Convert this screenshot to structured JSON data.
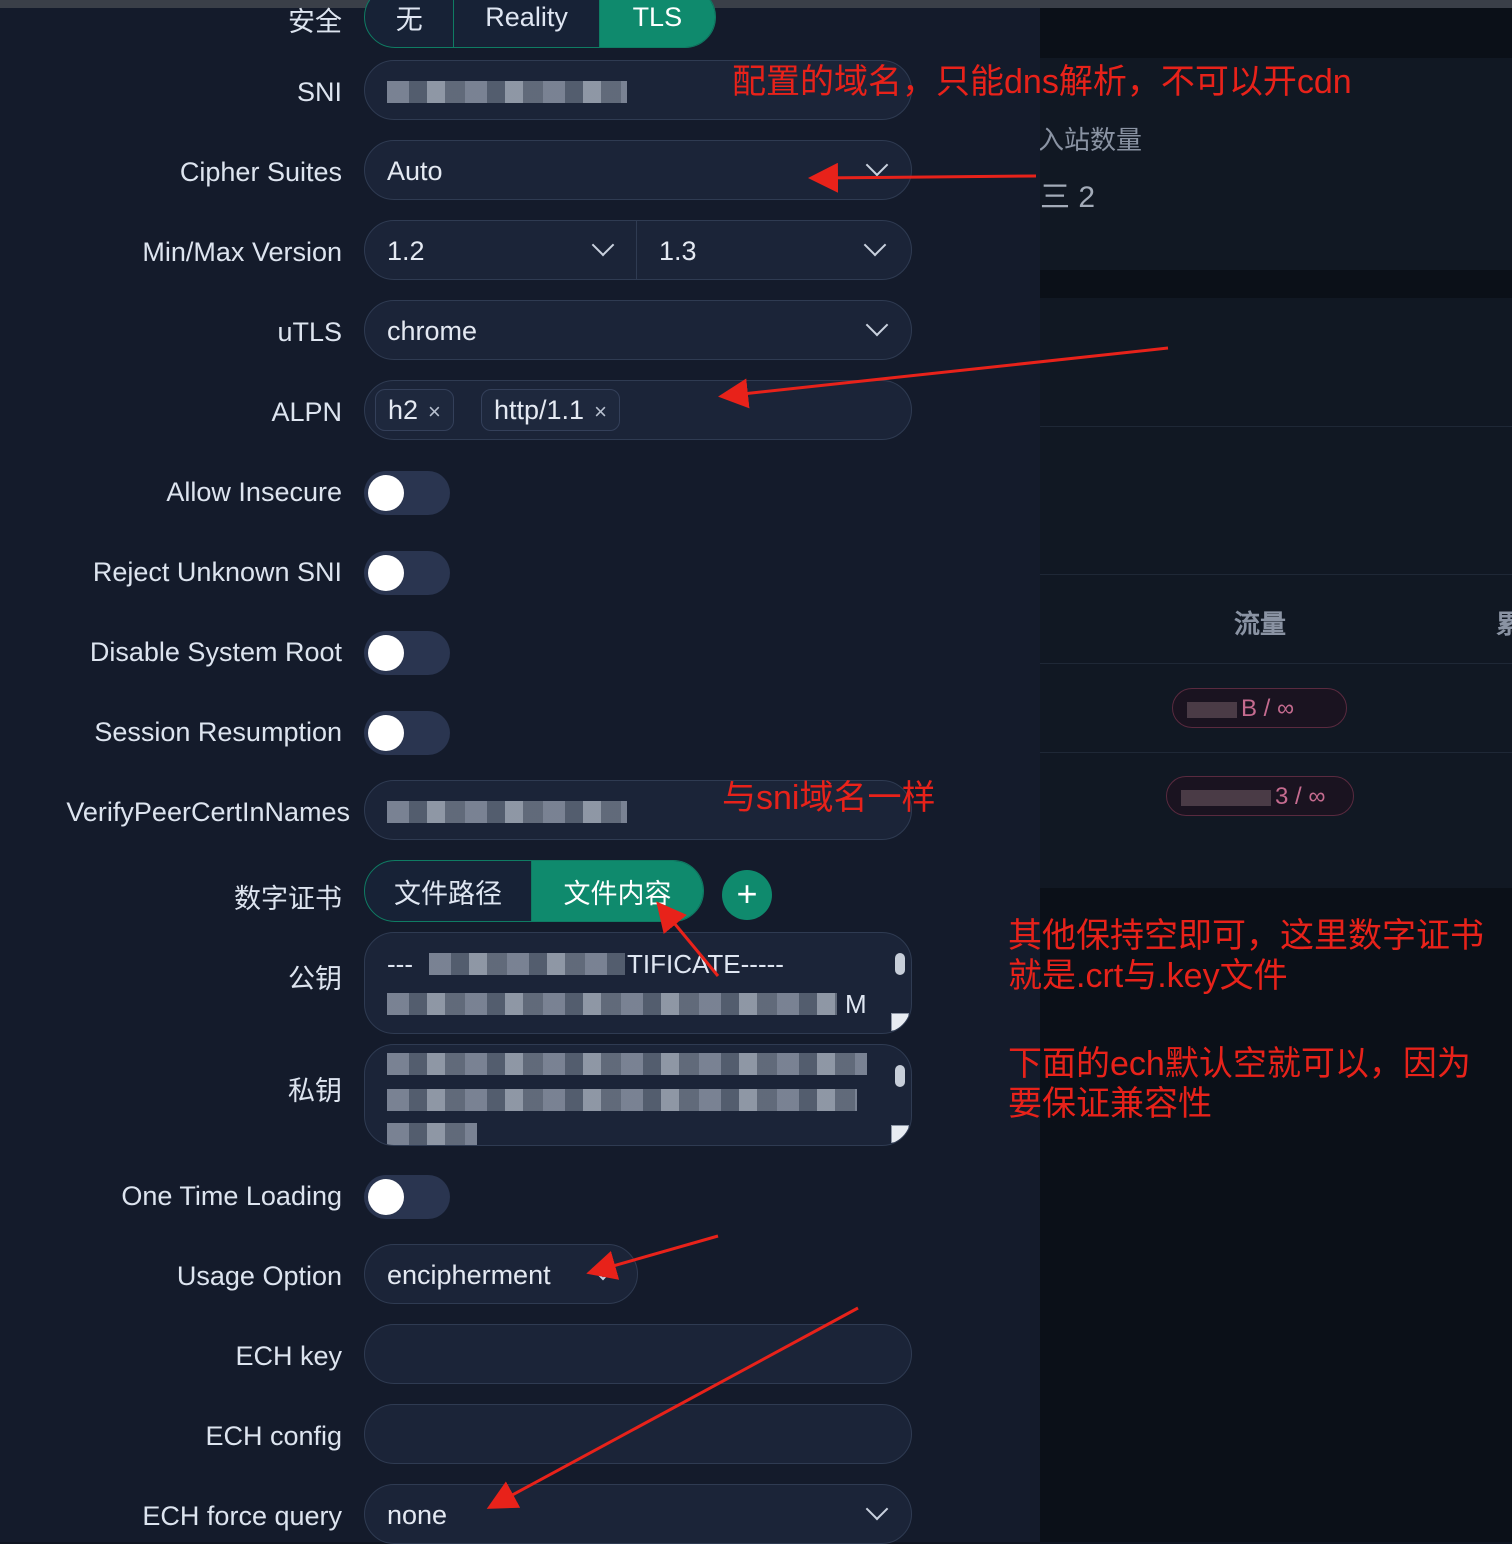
{
  "background_page": {
    "inbound_count_label": "入站数量",
    "inbound_count_value": "三 2",
    "traffic_header": "流量",
    "edge_header_glyph": "累",
    "rows": [
      {
        "traffic": "B / ∞"
      },
      {
        "traffic": "3 / ∞"
      }
    ]
  },
  "security": {
    "label": "安全",
    "options": [
      "无",
      "Reality",
      "TLS"
    ],
    "selected": "TLS"
  },
  "fields": {
    "sni": {
      "label": "SNI",
      "value": ""
    },
    "cipher_suites": {
      "label": "Cipher Suites",
      "value": "Auto"
    },
    "min_max_version": {
      "label": "Min/Max Version",
      "min": "1.2",
      "max": "1.3"
    },
    "utls": {
      "label": "uTLS",
      "value": "chrome"
    },
    "alpn": {
      "label": "ALPN",
      "tags": [
        "h2",
        "http/1.1"
      ],
      "remove_glyph": "×"
    },
    "allow_insecure": {
      "label": "Allow Insecure"
    },
    "reject_unknown_sni": {
      "label": "Reject Unknown SNI"
    },
    "disable_system_root": {
      "label": "Disable System Root"
    },
    "session_resumption": {
      "label": "Session Resumption"
    },
    "verify_peer_cert_in_names": {
      "label": "VerifyPeerCertInNames"
    },
    "certificate": {
      "label": "数字证书",
      "options": [
        "文件路径",
        "文件内容"
      ],
      "selected": "文件内容",
      "add_glyph": "+"
    },
    "public_key": {
      "label": "公钥",
      "visible_start": "---",
      "visible_mid": "TIFICATE-----",
      "visible_end": "M"
    },
    "private_key": {
      "label": "私钥"
    },
    "one_time_loading": {
      "label": "One Time Loading"
    },
    "usage_option": {
      "label": "Usage Option",
      "value": "encipherment"
    },
    "ech_key": {
      "label": "ECH key",
      "value": ""
    },
    "ech_config": {
      "label": "ECH config",
      "value": ""
    },
    "ech_force_query": {
      "label": "ECH force query",
      "value": "none"
    }
  },
  "annotations": {
    "sni_note": "配置的域名，只能dns解析，不可以开cdn",
    "verify_note": "与sni域名一样",
    "cert_note_line1": "其他保持空即可，这里数字证书",
    "cert_note_line2": "就是.crt与.key文件",
    "ech_note_line1": "下面的ech默认空就可以，因为",
    "ech_note_line2": "要保证兼容性",
    "arrow_color": "#e8221a"
  },
  "colors": {
    "accent": "#0f8a6d",
    "modal_bg": "#141b2b",
    "field_bg": "#1b2438"
  }
}
